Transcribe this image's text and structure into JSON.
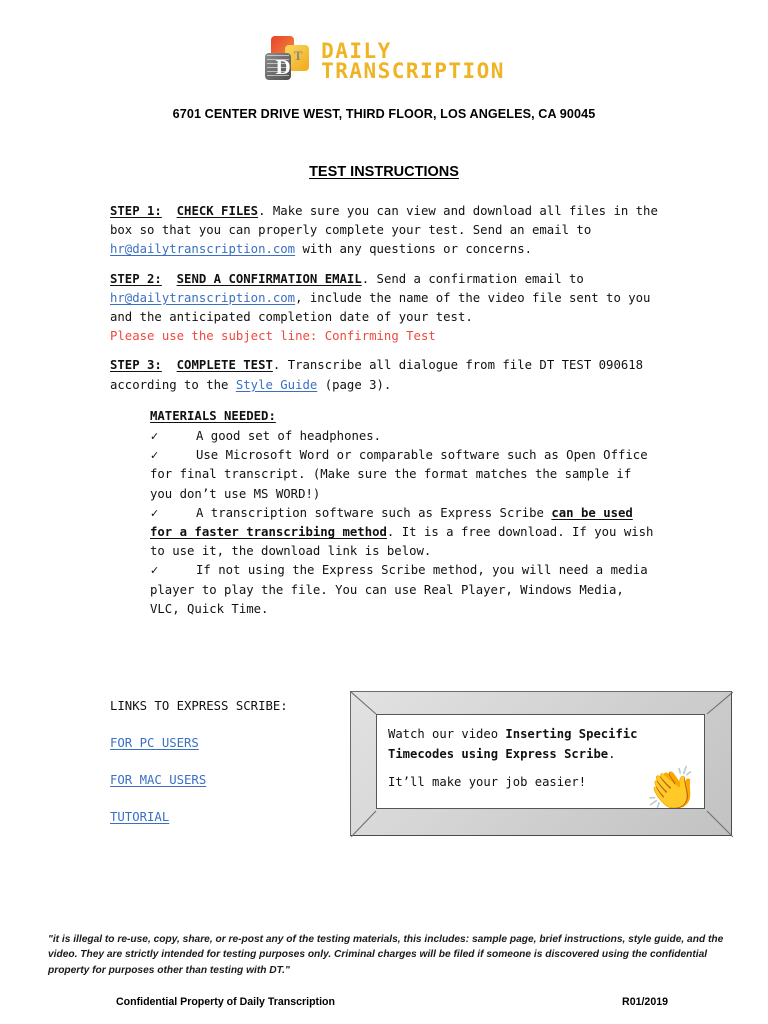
{
  "header": {
    "logo_line1": "DAILY",
    "logo_line2": "TRANSCRIPTION",
    "logo_letter_d": "D",
    "logo_letter_t": "T",
    "address": "6701 CENTER DRIVE WEST, THIRD FLOOR, LOS ANGELES, CA 90045",
    "accent_yellow": "#efb424",
    "accent_red": "#e8412e",
    "accent_gray": "#6b6b6b"
  },
  "title": "TEST INSTRUCTIONS",
  "steps": {
    "step1": {
      "label": "STEP 1:",
      "heading": "CHECK FILES",
      "text_before_link": ". Make sure you can view and download all files in the box so that you can properly complete your test.  Send an email to ",
      "link": "hr@dailytranscription.com",
      "text_after_link": " with any questions or concerns."
    },
    "step2": {
      "label": "STEP 2:",
      "heading": "SEND A CONFIRMATION EMAIL",
      "text_before_link": ".  Send a confirmation email to ",
      "link": "hr@dailytranscription.com",
      "text_after_link": ", include the name of the video file sent to you and the anticipated completion date of your test.",
      "red_note": "Please use the subject line:  Confirming Test"
    },
    "step3": {
      "label": "STEP 3:",
      "heading": "COMPLETE TEST",
      "text_before_link": ".  Transcribe all dialogue from file DT TEST 090618 according to the ",
      "link": "Style Guide",
      "text_after_link": " (page 3)."
    }
  },
  "materials": {
    "title": "MATERIALS NEEDED:",
    "check_glyph": "✓",
    "items": [
      {
        "text": "A good set of headphones."
      },
      {
        "text": "Use Microsoft Word or comparable software such as Open Office for final transcript. (Make sure the format matches the sample if you don’t use MS WORD!)"
      },
      {
        "text_before_bold": "A transcription software such as Express Scribe ",
        "bold_text": "can be used for a faster transcribing method",
        "text_after_bold": ".  It is a free download.  If you wish to use it, the download link is below."
      },
      {
        "text": "If not using the Express Scribe method, you will need a media player to play the file.  You can use Real Player, Windows Media, VLC, Quick Time."
      }
    ]
  },
  "links_section": {
    "title": "LINKS TO EXPRESS SCRIBE:",
    "links": [
      "FOR PC USERS ",
      "FOR MAC USERS",
      "TUTORIAL"
    ],
    "link_color": "#3a6fc4"
  },
  "video_box": {
    "line1_plain": "Watch our video ",
    "line1_bold": "Inserting Specific Timecodes using Express Scribe",
    "line1_end": ".",
    "line2": "It’ll make your job easier!",
    "emoji": "👏"
  },
  "footer": {
    "legal": "\"it is illegal to re-use, copy, share, or re-post any of the testing materials, this includes:  sample page, brief instructions, style guide, and the video.  They are strictly intended for testing purposes only.  Criminal charges will be filed if someone is discovered using the confidential property for purposes other than testing with DT.\"",
    "confidential": "Confidential Property of Daily Transcription",
    "revision": "R01/2019"
  }
}
